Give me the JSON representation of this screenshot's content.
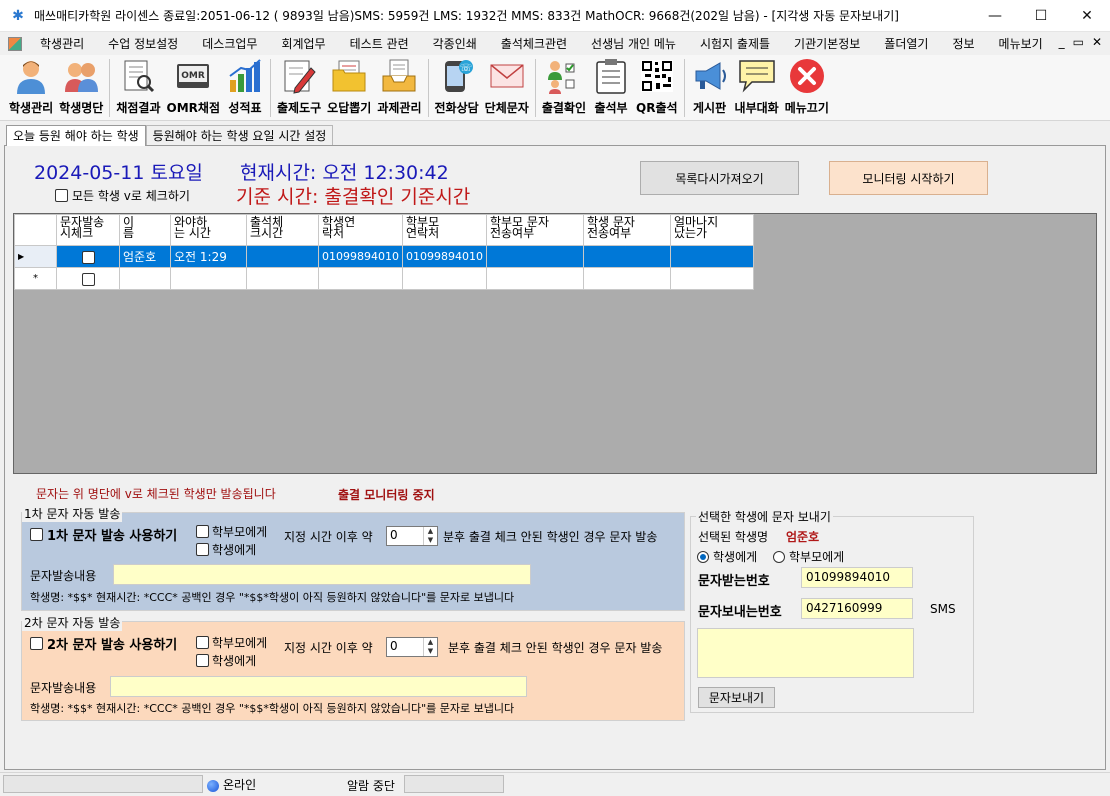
{
  "window": {
    "title": "매쓰매티카학원  라이센스 종료일:2051-06-12 ( 9893일 남음)SMS: 5959건 LMS: 1932건 MMS: 833건  MathOCR: 9668건(202일 남음) - [지각생 자동 문자보내기]",
    "minimize": "—",
    "maximize": "☐",
    "close": "✕"
  },
  "menu": {
    "items": [
      "학생관리",
      "수업 정보설정",
      "데스크업무",
      "회계업무",
      "테스트 관련",
      "각종인쇄",
      "출석체크관련",
      "선생님 개인 메뉴",
      "시험지 출제틀",
      "기관기본정보",
      "폴더열기",
      "정보",
      "메뉴보기"
    ],
    "right": [
      "_",
      "▭",
      "✕"
    ]
  },
  "toolbar": {
    "buttons": [
      {
        "label": "학생관리",
        "icon": "student-icon"
      },
      {
        "label": "학생명단",
        "icon": "student-list-icon"
      },
      {
        "label": "채점결과",
        "icon": "grading-result-icon"
      },
      {
        "label": "OMR채점",
        "icon": "omr-icon",
        "badge": "OMR"
      },
      {
        "label": "성적표",
        "icon": "bar-chart-icon"
      },
      {
        "label": "출제도구",
        "icon": "pencil-icon"
      },
      {
        "label": "오답뽑기",
        "icon": "folder-icon"
      },
      {
        "label": "과제관리",
        "icon": "tray-icon"
      },
      {
        "label": "전화상담",
        "icon": "phone-icon"
      },
      {
        "label": "단체문자",
        "icon": "envelope-icon"
      },
      {
        "label": "출결확인",
        "icon": "attendance-icon"
      },
      {
        "label": "출석부",
        "icon": "clipboard-icon"
      },
      {
        "label": "QR출석",
        "icon": "qr-icon"
      },
      {
        "label": "게시판",
        "icon": "megaphone-icon"
      },
      {
        "label": "내부대화",
        "icon": "chat-icon"
      },
      {
        "label": "메뉴끄기",
        "icon": "close-circle-icon"
      }
    ]
  },
  "tabs": [
    "오늘 등원 해야 하는 학생",
    "등원해야 하는 학생 요일 시간 설정"
  ],
  "header": {
    "date": "2024-05-11 토요일",
    "current_time": "현재시간: 오전 12:30:42",
    "base_time": "기준 시간: 출결확인 기준시간",
    "check_all": "모든 학생 v로 체크하기",
    "reload_btn": "목록다시가져오기",
    "monitor_btn": "모니터링 시작하기"
  },
  "grid": {
    "columns": [
      "문자발송\n시체크",
      "이\n름",
      "와야하\n는 시간",
      "출석체\n크시간",
      "학생연\n락처",
      "학부모\n연락처",
      "학부모 문자\n전송여부",
      "학생 문자\n전송여부",
      "얼마나지\n났는가"
    ],
    "rows": [
      {
        "name": "엄준호",
        "due": "오전 1:29",
        "checkin": "",
        "student_phone": "01099894010",
        "parent_phone": "01099894010",
        "parent_sent": "",
        "student_sent": "",
        "elapsed": ""
      }
    ]
  },
  "notice": "문자는 위 명단에 v로 체크된 학생만 발송됩니다",
  "status_stopped": "출결 모니터링 중지",
  "first": {
    "group_title": "1차 문자 자동 발송",
    "enable": "1차 문자 발송 사용하기",
    "to_parent": "학부모에게",
    "to_student": "학생에게",
    "after": "지정 시간 이후 약",
    "minutes": "0",
    "desc": "분후 출결 체크 안된 학생인 경우 문자 발송",
    "content_label": "문자발송내용",
    "content": "",
    "hint": "학생명:  *$$*  현재시간: *CCC*  공백인 경우  \"*$$*학생이 아직 등원하지 않았습니다\"를 문자로 보냅니다"
  },
  "second": {
    "group_title": "2차 문자 자동 발송",
    "enable": "2차 문자 발송 사용하기",
    "to_parent": "학부모에게",
    "to_student": "학생에게",
    "after": "지정 시간 이후 약",
    "minutes": "0",
    "desc": "분후 출결 체크 안된 학생인 경우 문자 발송",
    "content_label": "문자발송내용",
    "content": "",
    "hint": "학생명:  *$$*  현재시간: *CCC*  공백인 경우  \"*$$*학생이 아직 등원하지 않았습니다\"를 문자로 보냅니다"
  },
  "send_panel": {
    "title": "선택한 학생에 문자 보내기",
    "selected_label": "선택된 학생명",
    "selected_name": "엄준호",
    "to_student": "학생에게",
    "to_parent": "학부모에게",
    "recv_label": "문자받는번호",
    "recv_value": "01099894010",
    "send_label": "문자보내는번호",
    "send_value": "0427160999",
    "type": "SMS",
    "message": "",
    "send_btn": "문자보내기"
  },
  "statusbar": {
    "online": "온라인",
    "alarm": "알람 중단"
  },
  "colors": {
    "accent": "#0078d7",
    "date_blue": "#1a1ab8",
    "warn_red": "#c01818",
    "first_bg": "#b9c9de",
    "second_bg": "#fcd9bd",
    "field_yellow": "#ffffc8"
  }
}
